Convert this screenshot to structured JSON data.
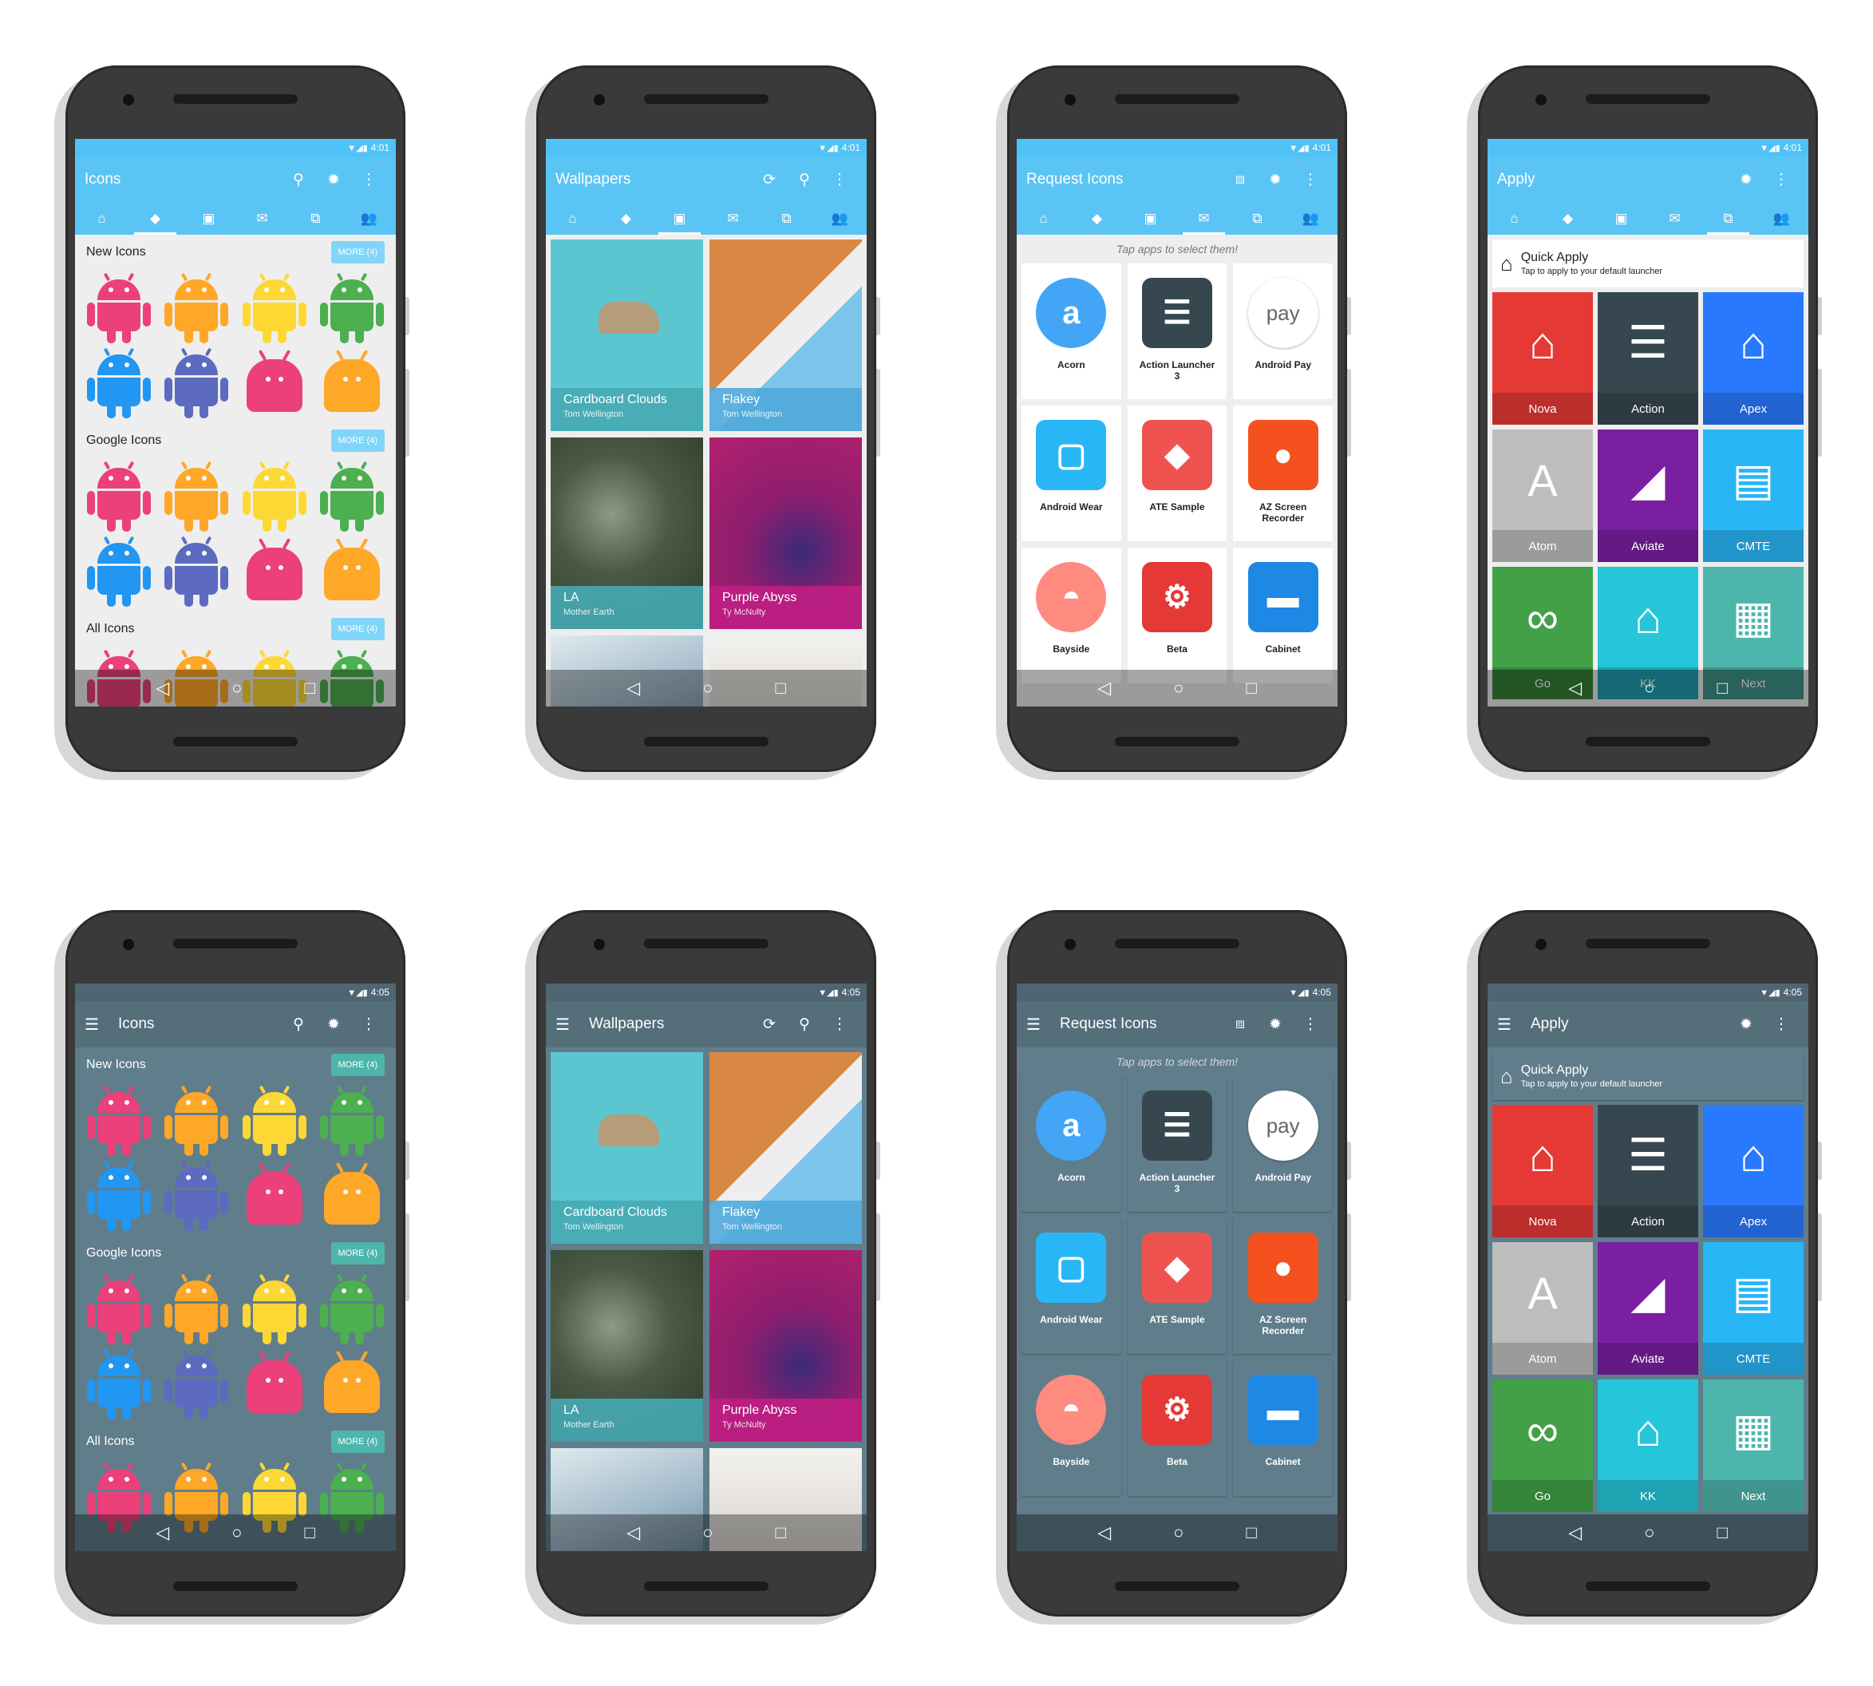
{
  "status_time_light": "4:01",
  "status_time_dark": "4:05",
  "tabs_icons": [
    "⌂",
    "◆",
    "▣",
    "✉",
    "⧉",
    "👥"
  ],
  "icons_screen": {
    "title": "Icons",
    "sections": [
      {
        "label": "New Icons",
        "more": "MORE (4)"
      },
      {
        "label": "Google Icons",
        "more": "MORE (4)"
      },
      {
        "label": "All Icons",
        "more": "MORE (4)"
      }
    ],
    "colors": [
      "#ec407a",
      "#ffa726",
      "#fdd835",
      "#4caf50",
      "#2196f3",
      "#5c6bc0",
      "#ec407a",
      "#ffa726"
    ]
  },
  "wallpapers_screen": {
    "title": "Wallpapers",
    "items": [
      {
        "name": "Cardboard Clouds",
        "author": "Tom Wellington"
      },
      {
        "name": "Flakey",
        "author": "Tom Wellington"
      },
      {
        "name": "LA",
        "author": "Mother Earth"
      },
      {
        "name": "Purple Abyss",
        "author": "Ty McNulty"
      }
    ]
  },
  "request_screen": {
    "title": "Request Icons",
    "hint": "Tap apps to select them!",
    "apps": [
      {
        "label": "Acorn",
        "glyph": "a",
        "color": "#42a5f5"
      },
      {
        "label": "Action Launcher 3",
        "glyph": "☰",
        "color": "#37474f"
      },
      {
        "label": "Android Pay",
        "glyph": "pay",
        "color": "#ffffff"
      },
      {
        "label": "Android Wear",
        "glyph": "▢",
        "color": "#29b6f6"
      },
      {
        "label": "ATE Sample",
        "glyph": "◆",
        "color": "#ef5350"
      },
      {
        "label": "AZ Screen Recorder",
        "glyph": "●",
        "color": "#f4511e"
      },
      {
        "label": "Bayside",
        "glyph": "◓",
        "color": "#ff8a80"
      },
      {
        "label": "Beta",
        "glyph": "⚙",
        "color": "#e53935"
      },
      {
        "label": "Cabinet",
        "glyph": "▬",
        "color": "#1e88e5"
      }
    ]
  },
  "apply_screen": {
    "title": "Apply",
    "quick_title": "Quick Apply",
    "quick_sub": "Tap to apply to your default launcher",
    "launchers": [
      {
        "label": "Nova",
        "bg": "#e53935",
        "glyph": "⌂"
      },
      {
        "label": "Action",
        "bg": "#37474f",
        "glyph": "☰"
      },
      {
        "label": "Apex",
        "bg": "#2979ff",
        "glyph": "⌂"
      },
      {
        "label": "Atom",
        "bg": "#bdbdbd",
        "glyph": "A"
      },
      {
        "label": "Aviate",
        "bg": "#7b1fa2",
        "glyph": "◢"
      },
      {
        "label": "CMTE",
        "bg": "#29b6f6",
        "glyph": "▤"
      },
      {
        "label": "Go",
        "bg": "#43a047",
        "glyph": "∞"
      },
      {
        "label": "KK",
        "bg": "#26c6da",
        "glyph": "⌂"
      },
      {
        "label": "Next",
        "bg": "#4db6ac",
        "glyph": "▦"
      }
    ]
  }
}
